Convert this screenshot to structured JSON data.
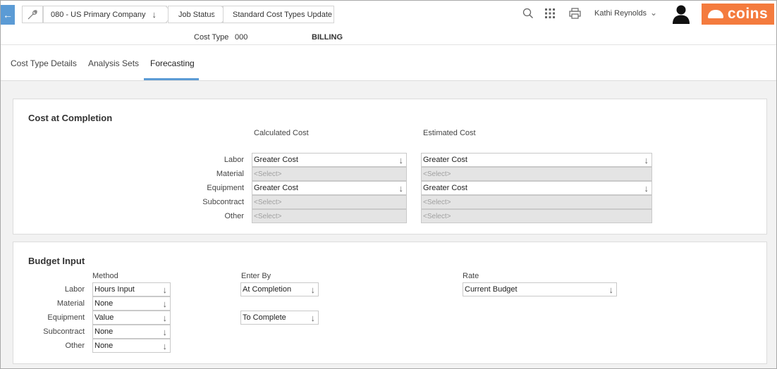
{
  "breadcrumb": {
    "company": "080 - US Primary Company",
    "job_status": "Job Status",
    "page": "Standard Cost Types Update"
  },
  "user": {
    "name": "Kathi Reynolds"
  },
  "logo": {
    "text": "coins"
  },
  "header": {
    "cost_type_label": "Cost Type",
    "cost_type_code": "000",
    "cost_type_name": "BILLING"
  },
  "tabs": [
    {
      "label": "Cost Type Details"
    },
    {
      "label": "Analysis Sets"
    },
    {
      "label": "Forecasting"
    }
  ],
  "completion": {
    "title": "Cost at Completion",
    "col_calculated": "Calculated Cost",
    "col_estimated": "Estimated Cost",
    "rows": [
      {
        "label": "Labor",
        "calculated": "Greater Cost",
        "estimated": "Greater Cost"
      },
      {
        "label": "Material",
        "calculated": "<Select>",
        "estimated": "<Select>"
      },
      {
        "label": "Equipment",
        "calculated": "Greater Cost",
        "estimated": "Greater Cost"
      },
      {
        "label": "Subcontract",
        "calculated": "<Select>",
        "estimated": "<Select>"
      },
      {
        "label": "Other",
        "calculated": "<Select>",
        "estimated": "<Select>"
      }
    ]
  },
  "budget": {
    "title": "Budget Input",
    "col_method": "Method",
    "col_enter_by": "Enter By",
    "col_rate": "Rate",
    "rows": [
      {
        "label": "Labor",
        "method": "Hours Input",
        "enter_by": "At Completion",
        "rate": "Current Budget"
      },
      {
        "label": "Material",
        "method": "None"
      },
      {
        "label": "Equipment",
        "method": "Value",
        "enter_by": "To Complete"
      },
      {
        "label": "Subcontract",
        "method": "None"
      },
      {
        "label": "Other",
        "method": "None"
      }
    ]
  },
  "icons": {
    "back": "arrow-left-icon",
    "wrench": "wrench-icon",
    "search": "search-icon",
    "apps": "grid-icon",
    "print": "printer-icon",
    "user": "user-avatar-icon",
    "dropdown": "arrow-down-icon"
  },
  "colors": {
    "accent": "#5b9bd5",
    "brand": "#f47b3e",
    "disabled_bg": "#e4e4e4"
  }
}
